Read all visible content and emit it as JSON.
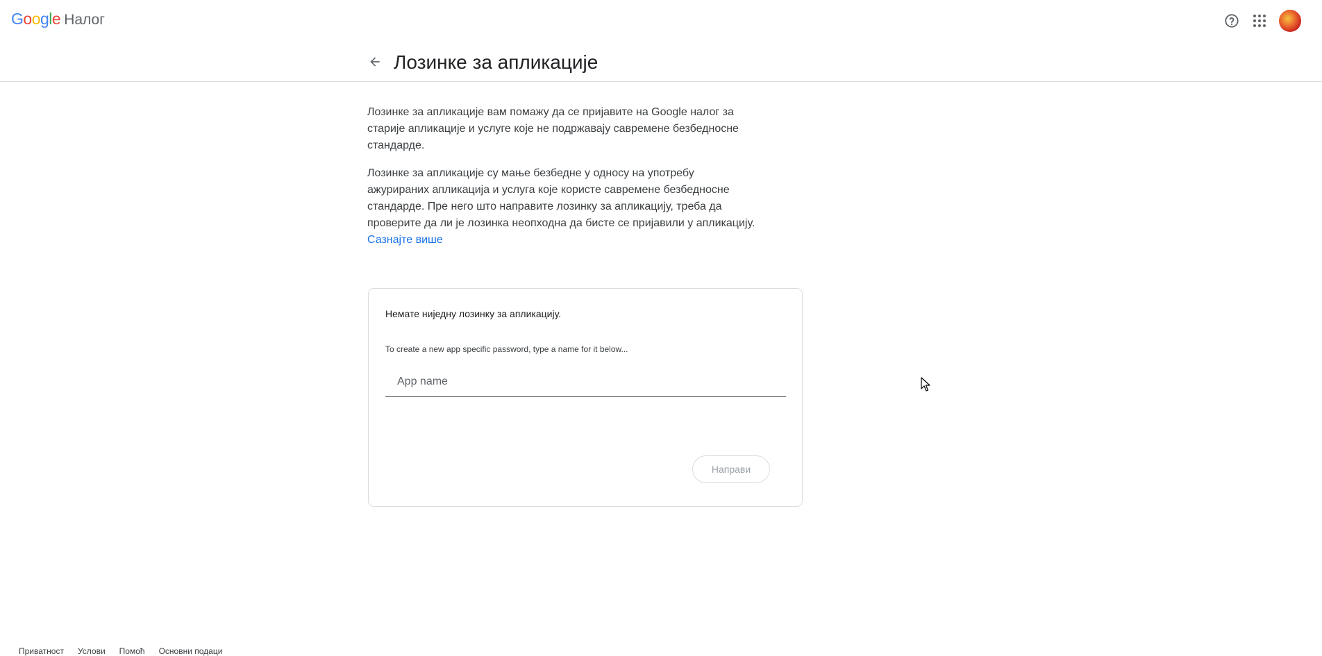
{
  "header": {
    "logo_text": [
      "G",
      "o",
      "o",
      "g",
      "l",
      "e"
    ],
    "logo_colors": [
      "#4285F4",
      "#EA4335",
      "#FBBC05",
      "#4285F4",
      "#34A853",
      "#EA4335"
    ],
    "product": "Налог",
    "icons": [
      "help-icon",
      "apps-grid-icon",
      "avatar"
    ]
  },
  "subheader": {
    "title": "Лозинке за апликације",
    "back_icon": "arrow-left-icon"
  },
  "content": {
    "para1": "Лозинке за апликације вам помажу да се пријавите на Google налог за старије апликације и услуге које не подржавају савремене безбедносне стандарде.",
    "para2": "Лозинке за апликације су мање безбедне у односу на употребу ажурираних апликација и услуга које користе савремене безбедносне стандарде. Пре него што направите лозинку за апликацију, треба да проверите да ли је лозинка неопходна да бисте се пријавили у апликацију.",
    "learn_more": "Сазнајте више"
  },
  "card": {
    "empty_message": "Немате ниједну лозинку за апликацију.",
    "hint": "To create a new app specific password, type a name for it below...",
    "input_value": "",
    "input_placeholder": "App name",
    "create_button": "Направи"
  },
  "footer": {
    "links": [
      "Приватност",
      "Услови",
      "Помоћ",
      "Основни подаци"
    ]
  },
  "colors": {
    "link": "#1a73e8",
    "divider": "#dadce0",
    "disabled_text": "#9aa0a6"
  }
}
